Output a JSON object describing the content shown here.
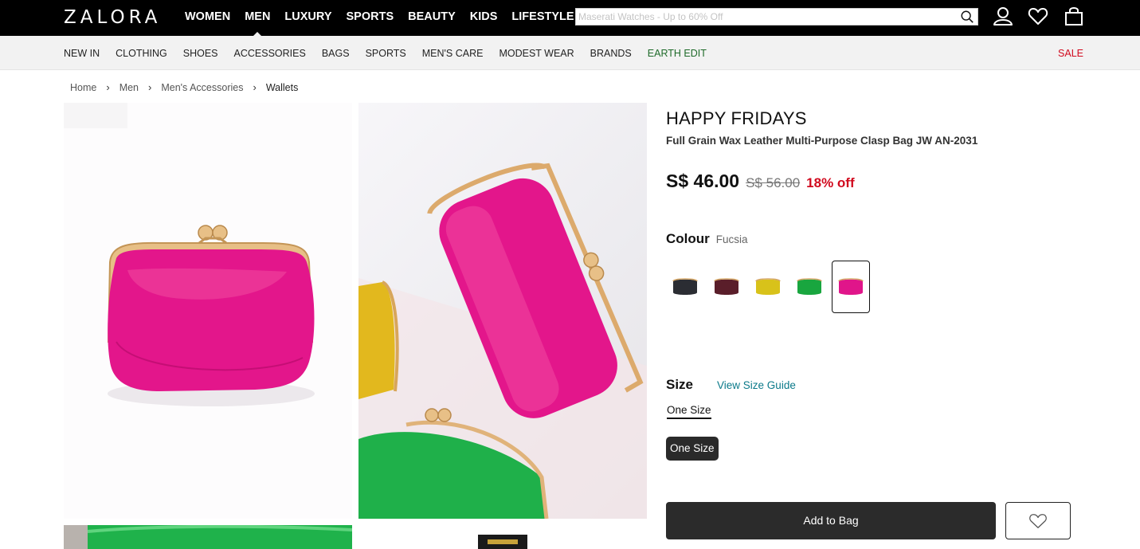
{
  "header": {
    "logo": "ZALORA",
    "nav": [
      "WOMEN",
      "MEN",
      "LUXURY",
      "SPORTS",
      "BEAUTY",
      "KIDS",
      "LIFESTYLE"
    ],
    "active_nav": "MEN",
    "search_placeholder": "Maserati Watches - Up to 60% Off",
    "icons": [
      "search-icon",
      "account-icon",
      "wishlist-heart-icon",
      "shopping-bag-icon"
    ]
  },
  "subnav": {
    "items": [
      "NEW IN",
      "CLOTHING",
      "SHOES",
      "ACCESSORIES",
      "BAGS",
      "SPORTS",
      "MEN'S CARE",
      "MODEST WEAR",
      "BRANDS",
      "EARTH EDIT"
    ],
    "sale": "SALE"
  },
  "breadcrumb": [
    "Home",
    "Men",
    "Men's Accessories",
    "Wallets"
  ],
  "product": {
    "brand": "HAPPY FRIDAYS",
    "name": "Full Grain Wax Leather Multi-Purpose Clasp Bag JW AN-2031",
    "price": "S$ 46.00",
    "original_price": "S$ 56.00",
    "discount": "18% off",
    "colour_label": "Colour",
    "colour_value": "Fucsia",
    "swatch_colors": [
      "#2b2d33",
      "#5a1e2a",
      "#d8c21a",
      "#19a63f",
      "#e0158a"
    ],
    "selected_swatch": 4,
    "size_label": "Size",
    "size_guide": "View Size Guide",
    "size_tab": "One Size",
    "size_option": "One Size",
    "add_to_bag": "Add to Bag"
  },
  "colors": {
    "accent_red": "#d10a1e",
    "earth_green": "#1f6b2a",
    "link_teal": "#0b7a8a",
    "product_pink": "#e0158a"
  }
}
